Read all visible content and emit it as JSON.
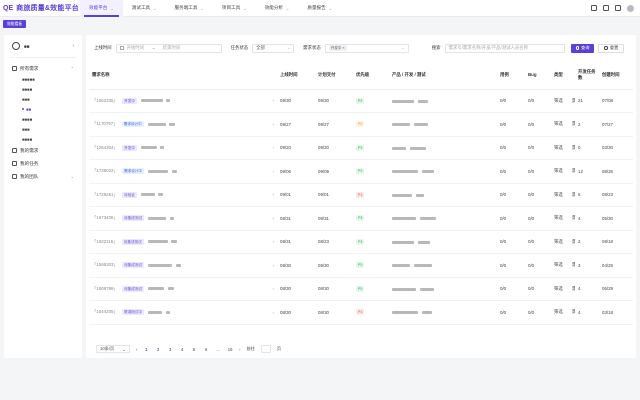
{
  "app": {
    "logo_mark": "QE",
    "title": "商旅质量&效能平台"
  },
  "nav": [
    {
      "label": "效能平台",
      "active": true
    },
    {
      "label": "測试工具",
      "active": false
    },
    {
      "label": "服务端工具",
      "active": false
    },
    {
      "label": "项目工具",
      "active": false
    },
    {
      "label": "效能分析",
      "active": false
    },
    {
      "label": "质量报告",
      "active": false
    }
  ],
  "subbar": {
    "tag": "效能看板"
  },
  "sidebar": {
    "user_name": "■■",
    "group_label": "所有需求",
    "sub_items": [
      "■■■■■",
      "■■■■",
      "■■■",
      "■■",
      "■■■■",
      "■■■",
      "■■■■"
    ],
    "items": [
      {
        "label": "我的需求"
      },
      {
        "label": "我的任务"
      },
      {
        "label": "我的团队"
      }
    ]
  },
  "filters": {
    "online_time_label": "上线时间",
    "start_placeholder": "开始时间",
    "end_placeholder": "结束时间",
    "date_sep": "~",
    "task_status_label": "任务状态",
    "task_status_value": "全部",
    "req_status_label": "需求状态",
    "req_status_chip": "开发中 ×",
    "search_label": "搜索",
    "search_placeholder": "需求号/需求名称/开发/产品/测试人员名称",
    "query_button": "查询",
    "reset_button": "重置"
  },
  "table": {
    "headers": [
      "需求名称",
      "",
      "上线时间",
      "计划交付",
      "优先级",
      "产品 / 开发 / 测试",
      "用例",
      "Bug",
      "类型",
      "开发任务数",
      "创建时间"
    ],
    "rows": [
      {
        "id": "「1062335」",
        "tag": "开发中",
        "tag_class": "tag-dev",
        "online": "09/30",
        "plan": "09/30",
        "pri": "P3",
        "cases": "0/0",
        "bug": "0/0",
        "type": "筛选",
        "type2": "需求",
        "tasks": "21",
        "created": "07/08"
      },
      {
        "id": "「1170797」",
        "tag": "需求设计中",
        "tag_class": "tag-design",
        "online": "09/27",
        "plan": "09/27",
        "pri": "P2",
        "cases": "0/0",
        "bug": "0/0",
        "type": "筛选",
        "type2": "需求",
        "tasks": "2",
        "created": "07/27"
      },
      {
        "id": "「1254304」",
        "tag": "开发中",
        "tag_class": "tag-dev",
        "online": "09/20",
        "plan": "09/20",
        "pri": "P3",
        "cases": "0/0",
        "bug": "0/0",
        "type": "筛选",
        "type2": "需求",
        "tasks": "0",
        "created": "03/30"
      },
      {
        "id": "「1735022」",
        "tag": "需求设计中",
        "tag_class": "tag-design",
        "online": "09/06",
        "plan": "09/09",
        "pri": "P3",
        "cases": "0/0",
        "bug": "0/0",
        "type": "筛选",
        "type2": "需求",
        "tasks": "12",
        "created": "08/25"
      },
      {
        "id": "「1729261」",
        "tag": "待验证",
        "tag_class": "tag-wait",
        "online": "09/01",
        "plan": "09/01",
        "pri": "P1",
        "cases": "0/0",
        "bug": "0/0",
        "type": "筛选",
        "type2": "需求",
        "tasks": "6",
        "created": "08/23"
      },
      {
        "id": "「1673406」",
        "tag": "待集成测试",
        "tag_class": "tag-done",
        "online": "08/31",
        "plan": "08/31",
        "pri": "P3",
        "cases": "0/0",
        "bug": "0/0",
        "type": "筛选",
        "type2": "需求",
        "tasks": "4",
        "created": "05/30"
      },
      {
        "id": "「1922116」",
        "tag": "待集成测试",
        "tag_class": "tag-done",
        "online": "08/31",
        "plan": "08/23",
        "pri": "P3",
        "cases": "0/0",
        "bug": "0/0",
        "type": "筛选",
        "type2": "需求",
        "tasks": "2",
        "created": "08/18"
      },
      {
        "id": "「1595303」",
        "tag": "待集成测试",
        "tag_class": "tag-done",
        "online": "08/30",
        "plan": "08/30",
        "pri": "P3",
        "cases": "0/0",
        "bug": "0/0",
        "type": "筛选",
        "type2": "需求",
        "tasks": "3",
        "created": "04/25"
      },
      {
        "id": "「1909799」",
        "tag": "待集成测试",
        "tag_class": "tag-done",
        "online": "08/30",
        "plan": "08/30",
        "pri": "P3",
        "cases": "0/0",
        "bug": "0/0",
        "type": "筛选",
        "type2": "需求",
        "tasks": "4",
        "created": "06/29"
      },
      {
        "id": "「1544205」",
        "tag": "联调测试中",
        "tag_class": "tag-done",
        "online": "08/30",
        "plan": "08/30",
        "pri": "P1",
        "cases": "0/0",
        "bug": "0/0",
        "type": "筛选",
        "type2": "需求",
        "tasks": "4",
        "created": "03/18"
      }
    ]
  },
  "pager": {
    "size": "10条/页",
    "pages": [
      "1",
      "2",
      "3",
      "4",
      "5",
      "6",
      "...",
      "16"
    ],
    "active": "1",
    "jump_label": "前往",
    "page_suffix": "页"
  },
  "colors": {
    "accent": "#5b3fd9",
    "p3": "#23a55a",
    "p2": "#e89020",
    "p1": "#e3394a"
  }
}
